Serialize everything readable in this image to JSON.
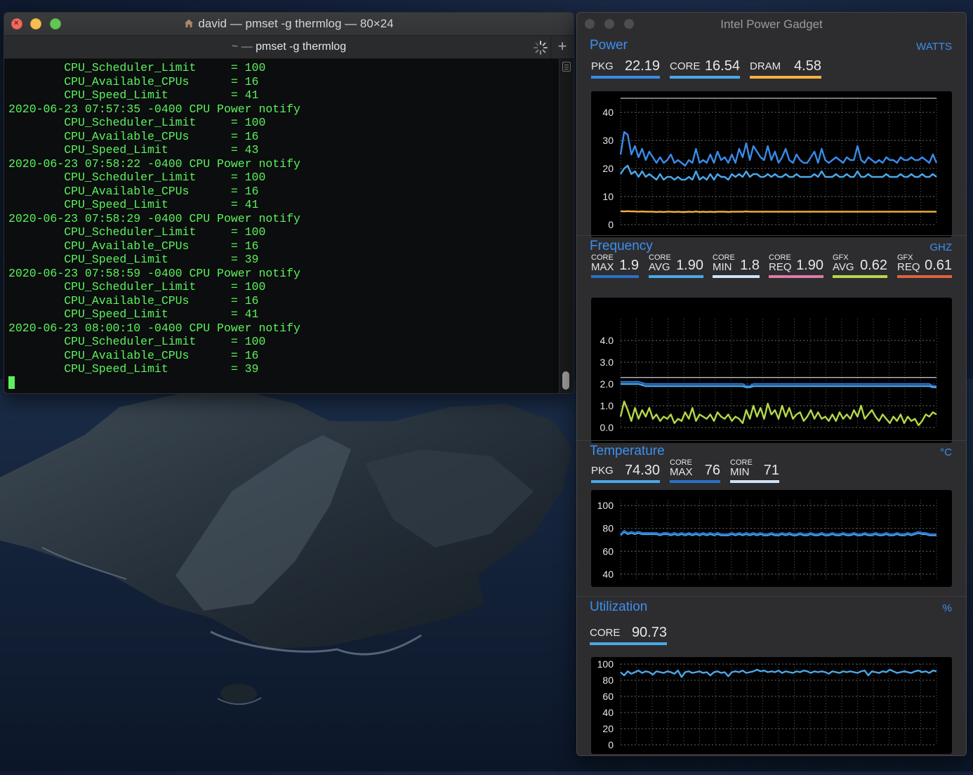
{
  "terminal": {
    "window_title": "david — pmset -g thermlog — 80×24",
    "tab_title_prefix": "~ —",
    "tab_title_command": "pmset -g thermlog",
    "new_tab_label": "+",
    "lines": [
      "        CPU_Scheduler_Limit     = 100",
      "        CPU_Available_CPUs      = 16",
      "        CPU_Speed_Limit         = 41",
      "2020-06-23 07:57:35 -0400 CPU Power notify",
      "        CPU_Scheduler_Limit     = 100",
      "        CPU_Available_CPUs      = 16",
      "        CPU_Speed_Limit         = 43",
      "2020-06-23 07:58:22 -0400 CPU Power notify",
      "        CPU_Scheduler_Limit     = 100",
      "        CPU_Available_CPUs      = 16",
      "        CPU_Speed_Limit         = 41",
      "2020-06-23 07:58:29 -0400 CPU Power notify",
      "        CPU_Scheduler_Limit     = 100",
      "        CPU_Available_CPUs      = 16",
      "        CPU_Speed_Limit         = 39",
      "2020-06-23 07:58:59 -0400 CPU Power notify",
      "        CPU_Scheduler_Limit     = 100",
      "        CPU_Available_CPUs      = 16",
      "        CPU_Speed_Limit         = 41",
      "2020-06-23 08:00:10 -0400 CPU Power notify",
      "        CPU_Scheduler_Limit     = 100",
      "        CPU_Available_CPUs      = 16",
      "        CPU_Speed_Limit         = 39"
    ],
    "colors": {
      "text": "#5cf25c",
      "background": "#0b0d0e"
    }
  },
  "gadget": {
    "window_title": "Intel Power Gadget",
    "power": {
      "title": "Power",
      "unit": "WATTS",
      "metrics": [
        {
          "label": "PKG",
          "value": "22.19",
          "color": "#3a8be8"
        },
        {
          "label": "CORE",
          "value": "16.54",
          "color": "#4aa8ea"
        },
        {
          "label": "DRAM",
          "value": "4.58",
          "color": "#f5b340"
        }
      ]
    },
    "frequency": {
      "title": "Frequency",
      "unit": "GHZ",
      "metrics": [
        {
          "small": "CORE",
          "big": "MAX",
          "value": "1.9",
          "color": "#2b71c8"
        },
        {
          "small": "CORE",
          "big": "AVG",
          "value": "1.90",
          "color": "#4aa8ea"
        },
        {
          "small": "CORE",
          "big": "MIN",
          "value": "1.8",
          "color": "#cfe3f5"
        },
        {
          "small": "CORE",
          "big": "REQ",
          "value": "1.90",
          "color": "#e07aa6"
        },
        {
          "small": "GFX",
          "big": "AVG",
          "value": "0.62",
          "color": "#b5d84a"
        },
        {
          "small": "GFX",
          "big": "REQ",
          "value": "0.61",
          "color": "#e0623e"
        }
      ]
    },
    "temperature": {
      "title": "Temperature",
      "unit": "°C",
      "metrics": [
        {
          "label": "PKG",
          "value": "74.30",
          "color": "#4aa8ea"
        },
        {
          "small": "CORE",
          "big": "MAX",
          "value": "76",
          "color": "#2b71c8"
        },
        {
          "small": "CORE",
          "big": "MIN",
          "value": "71",
          "color": "#cfe3f5"
        }
      ]
    },
    "utilization": {
      "title": "Utilization",
      "unit": "%",
      "metrics": [
        {
          "label": "CORE",
          "value": "90.73",
          "color": "#4aa8ea"
        }
      ]
    }
  },
  "chart_data": [
    {
      "type": "line",
      "id": "power",
      "ylim": [
        0,
        45
      ],
      "yticks": [
        "0",
        "10",
        "20",
        "30",
        "40"
      ],
      "limit_line": 45,
      "series": [
        {
          "color": "#3a8be8",
          "values": [
            25,
            33,
            32,
            25,
            28,
            24,
            27,
            23,
            26,
            24,
            22,
            24,
            22,
            23,
            25,
            22,
            23,
            22,
            21,
            23,
            22,
            27,
            22,
            23,
            22,
            25,
            22,
            26,
            23,
            24,
            22,
            25,
            22,
            27,
            24,
            29,
            23,
            28,
            26,
            24,
            23,
            28,
            23,
            26,
            22,
            24,
            27,
            23,
            22,
            25,
            23,
            22,
            22,
            24,
            26,
            22,
            27,
            23,
            22,
            23,
            24,
            23,
            22,
            24,
            23,
            23,
            28,
            23,
            22,
            24,
            23,
            22,
            23,
            22,
            24,
            23,
            23,
            22,
            24,
            23,
            23,
            24,
            23,
            23,
            24,
            23,
            22,
            25,
            22
          ]
        },
        {
          "color": "#4aa8ea",
          "values": [
            18,
            20,
            21,
            18,
            19,
            17,
            19,
            17,
            18,
            17,
            16,
            18,
            16,
            17,
            17,
            16,
            17,
            16,
            16,
            17,
            16,
            19,
            16,
            17,
            16,
            18,
            16,
            18,
            17,
            17,
            16,
            18,
            17,
            18,
            17,
            19,
            17,
            18,
            18,
            17,
            17,
            18,
            17,
            18,
            17,
            17,
            18,
            17,
            17,
            18,
            17,
            17,
            17,
            17,
            18,
            17,
            19,
            17,
            17,
            17,
            18,
            17,
            17,
            18,
            17,
            17,
            19,
            17,
            17,
            18,
            17,
            17,
            17,
            17,
            18,
            17,
            17,
            17,
            18,
            17,
            17,
            18,
            17,
            17,
            18,
            17,
            17,
            18,
            17
          ]
        },
        {
          "color": "#f5b340",
          "values": [
            4.8,
            4.7,
            4.8,
            4.7,
            4.7,
            4.6,
            4.7,
            4.6,
            4.6,
            4.6,
            4.5,
            4.6,
            4.5,
            4.6,
            4.6,
            4.5,
            4.6,
            4.5,
            4.5,
            4.6,
            4.5,
            4.7,
            4.5,
            4.6,
            4.5,
            4.6,
            4.5,
            4.6,
            4.6,
            4.6,
            4.5,
            4.6,
            4.6,
            4.6,
            4.6,
            4.7,
            4.6,
            4.6,
            4.6,
            4.6,
            4.6,
            4.6,
            4.6,
            4.6,
            4.6,
            4.6,
            4.6,
            4.6,
            4.6,
            4.6,
            4.6,
            4.6,
            4.6,
            4.6,
            4.6,
            4.6,
            4.6,
            4.6,
            4.6,
            4.6,
            4.6,
            4.6,
            4.6,
            4.6,
            4.6,
            4.6,
            4.6,
            4.6,
            4.6,
            4.6,
            4.6,
            4.6,
            4.6,
            4.6,
            4.6,
            4.6,
            4.6,
            4.6,
            4.6,
            4.6,
            4.6,
            4.6,
            4.6,
            4.6,
            4.6,
            4.6,
            4.6,
            4.6,
            4.6
          ]
        }
      ]
    },
    {
      "type": "line",
      "id": "frequency",
      "ylim": [
        0,
        5
      ],
      "yticks": [
        "0.0",
        "1.0",
        "2.0",
        "3.0",
        "4.0"
      ],
      "limit_line": 2.3,
      "series": [
        {
          "color": "#2b71c8",
          "values": [
            2.1,
            2.1,
            2.1,
            2.1,
            2.1,
            2.1,
            2.05,
            2.0,
            2.0,
            2.0,
            2.0,
            2.0,
            2.0,
            2.0,
            2.0,
            2.0,
            2.0,
            2.0,
            2.0,
            2.0,
            2.0,
            2.0,
            2.0,
            2.0,
            2.0,
            2.0,
            2.0,
            2.0,
            2.0,
            2.0,
            2.0,
            2.0,
            2.0,
            2.0,
            2.0,
            1.9,
            1.9,
            2.0,
            2.0,
            2.0,
            2.0,
            2.0,
            2.0,
            2.0,
            2.0,
            2.0,
            2.0,
            2.0,
            2.0,
            2.0,
            2.0,
            2.0,
            2.0,
            2.0,
            2.0,
            2.0,
            2.0,
            2.0,
            2.0,
            2.0,
            2.0,
            2.0,
            2.0,
            2.0,
            2.0,
            2.0,
            2.0,
            2.0,
            2.0,
            2.0,
            2.0,
            2.0,
            2.0,
            2.0,
            2.0,
            2.0,
            2.0,
            2.0,
            2.0,
            2.0,
            2.0,
            2.0,
            2.0,
            2.0,
            2.0,
            2.0,
            2.0,
            1.9,
            1.9
          ]
        },
        {
          "color": "#4aa8ea",
          "values": [
            2.0,
            2.0,
            2.0,
            2.0,
            2.0,
            2.0,
            1.95,
            1.9,
            1.9,
            1.9,
            1.9,
            1.9,
            1.9,
            1.9,
            1.9,
            1.9,
            1.9,
            1.9,
            1.9,
            1.9,
            1.9,
            1.9,
            1.9,
            1.9,
            1.9,
            1.9,
            1.9,
            1.9,
            1.9,
            1.9,
            1.9,
            1.9,
            1.9,
            1.9,
            1.9,
            1.85,
            1.85,
            1.9,
            1.9,
            1.9,
            1.9,
            1.9,
            1.9,
            1.9,
            1.9,
            1.9,
            1.9,
            1.9,
            1.9,
            1.9,
            1.9,
            1.9,
            1.9,
            1.9,
            1.9,
            1.9,
            1.9,
            1.9,
            1.9,
            1.9,
            1.9,
            1.9,
            1.9,
            1.9,
            1.9,
            1.9,
            1.9,
            1.9,
            1.9,
            1.9,
            1.9,
            1.9,
            1.9,
            1.9,
            1.9,
            1.9,
            1.9,
            1.9,
            1.9,
            1.9,
            1.9,
            1.9,
            1.9,
            1.9,
            1.9,
            1.9,
            1.9,
            1.85,
            1.85
          ]
        },
        {
          "color": "#b5d84a",
          "values": [
            0.5,
            1.2,
            0.8,
            0.3,
            0.9,
            0.4,
            0.8,
            0.5,
            0.9,
            0.4,
            0.6,
            0.3,
            0.5,
            0.4,
            0.6,
            0.2,
            0.4,
            0.3,
            0.7,
            0.4,
            0.9,
            0.3,
            0.6,
            0.5,
            0.4,
            0.6,
            0.3,
            0.7,
            0.5,
            0.4,
            0.6,
            0.3,
            0.5,
            0.4,
            0.2,
            0.8,
            0.4,
            1.0,
            0.5,
            0.9,
            0.4,
            1.1,
            0.6,
            0.8,
            0.4,
            1.0,
            0.5,
            0.9,
            0.4,
            0.6,
            0.7,
            0.3,
            0.5,
            0.8,
            0.4,
            0.7,
            0.4,
            0.5,
            0.3,
            0.6,
            0.3,
            0.7,
            0.4,
            0.6,
            0.4,
            0.8,
            0.5,
            1.0,
            0.4,
            0.6,
            0.8,
            0.5,
            0.3,
            0.6,
            0.4,
            0.2,
            0.5,
            0.3,
            0.6,
            0.2,
            0.5,
            0.3,
            0.4,
            0.1,
            0.3,
            0.6,
            0.5,
            0.7,
            0.6
          ]
        }
      ]
    },
    {
      "type": "line",
      "id": "temperature",
      "ylim": [
        35,
        105
      ],
      "yticks": [
        "40",
        "60",
        "80",
        "100"
      ],
      "series": [
        {
          "color": "#4aa8ea",
          "values": [
            74,
            77,
            75,
            76,
            75,
            76,
            75,
            75,
            75,
            75,
            75,
            74,
            75,
            75,
            74,
            75,
            74,
            75,
            74,
            75,
            74,
            75,
            74,
            75,
            74,
            75,
            74,
            75,
            74,
            74,
            74,
            75,
            74,
            75,
            74,
            75,
            74,
            75,
            74,
            75,
            74,
            74,
            75,
            74,
            74,
            75,
            74,
            75,
            74,
            74,
            75,
            74,
            74,
            75,
            74,
            74,
            75,
            74,
            74,
            75,
            74,
            74,
            75,
            74,
            74,
            75,
            74,
            74,
            75,
            74,
            74,
            75,
            74,
            74,
            75,
            74,
            74,
            75,
            74,
            74,
            75,
            74,
            75,
            76,
            75,
            75,
            74,
            74,
            74
          ]
        },
        {
          "color": "#2b71c8",
          "values": [
            75,
            78,
            76,
            77,
            76,
            77,
            76,
            76,
            76,
            76,
            76,
            75,
            76,
            76,
            75,
            76,
            75,
            76,
            75,
            76,
            75,
            76,
            75,
            76,
            75,
            76,
            75,
            76,
            75,
            75,
            75,
            76,
            75,
            76,
            75,
            76,
            75,
            76,
            75,
            76,
            75,
            75,
            76,
            75,
            75,
            76,
            75,
            76,
            75,
            75,
            76,
            75,
            75,
            76,
            75,
            75,
            76,
            75,
            75,
            76,
            75,
            75,
            76,
            75,
            75,
            76,
            75,
            75,
            76,
            75,
            75,
            76,
            75,
            75,
            76,
            75,
            75,
            76,
            75,
            75,
            76,
            75,
            76,
            77,
            76,
            76,
            75,
            75,
            75
          ]
        }
      ]
    },
    {
      "type": "line",
      "id": "utilization",
      "ylim": [
        0,
        100
      ],
      "yticks": [
        "0",
        "20",
        "40",
        "60",
        "80",
        "100"
      ],
      "series": [
        {
          "color": "#4aa8ea",
          "values": [
            90,
            86,
            91,
            88,
            90,
            92,
            89,
            91,
            90,
            87,
            91,
            90,
            89,
            91,
            90,
            88,
            92,
            84,
            90,
            91,
            89,
            90,
            91,
            89,
            90,
            86,
            90,
            91,
            89,
            90,
            85,
            90,
            91,
            90,
            92,
            89,
            90,
            91,
            93,
            91,
            92,
            90,
            91,
            90,
            92,
            89,
            91,
            90,
            89,
            91,
            90,
            92,
            91,
            89,
            91,
            90,
            91,
            90,
            88,
            91,
            90,
            89,
            91,
            90,
            91,
            90,
            89,
            91,
            92,
            86,
            91,
            90,
            89,
            91,
            90,
            93,
            91,
            89,
            90,
            91,
            90,
            89,
            91,
            92,
            90,
            91,
            89,
            92,
            91
          ]
        }
      ]
    }
  ]
}
